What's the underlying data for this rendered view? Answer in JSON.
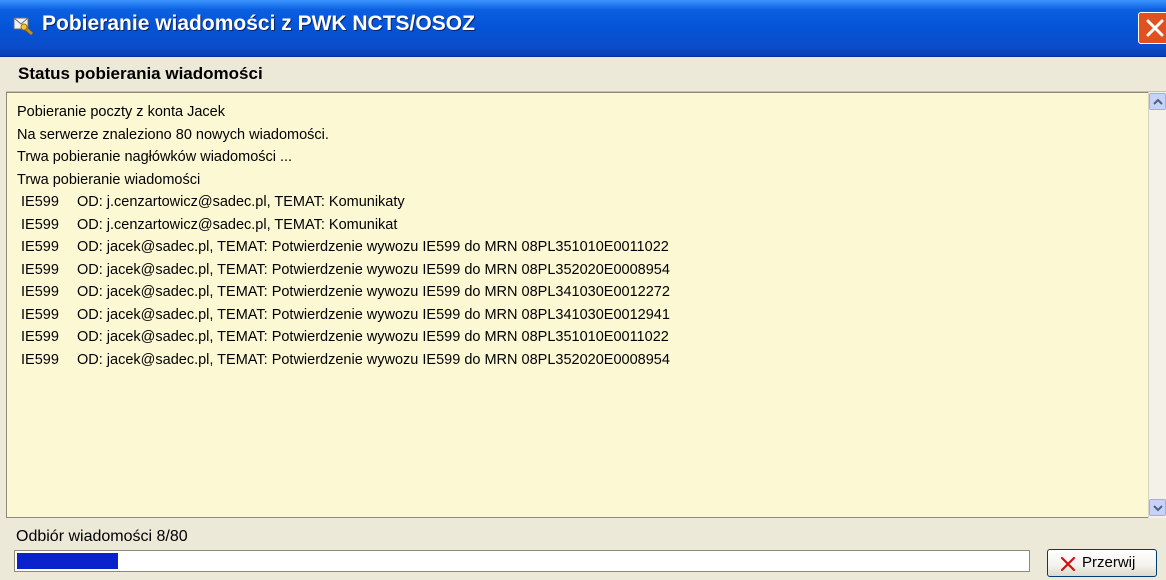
{
  "window": {
    "title": "Pobieranie wiadomości z PWK NCTS/OSOZ",
    "close_label": "×"
  },
  "section": {
    "header": "Status pobierania wiadomości"
  },
  "log": {
    "lines": [
      "Pobieranie poczty z konta Jacek",
      "Na serwerze znaleziono 80 nowych wiadomości.",
      "Trwa pobieranie nagłówków wiadomości ...",
      "Trwa pobieranie wiadomości"
    ],
    "messages": [
      {
        "code": "IE599",
        "text": "OD: j.cenzartowicz@sadec.pl, TEMAT: Komunikaty"
      },
      {
        "code": "IE599",
        "text": "OD: j.cenzartowicz@sadec.pl, TEMAT: Komunikat"
      },
      {
        "code": "IE599",
        "text": "OD: jacek@sadec.pl, TEMAT: Potwierdzenie wywozu IE599 do MRN 08PL351010E0011022"
      },
      {
        "code": "IE599",
        "text": "OD: jacek@sadec.pl, TEMAT: Potwierdzenie wywozu IE599 do MRN 08PL352020E0008954"
      },
      {
        "code": "IE599",
        "text": "OD: jacek@sadec.pl, TEMAT: Potwierdzenie wywozu IE599 do MRN 08PL341030E0012272"
      },
      {
        "code": "IE599",
        "text": "OD: jacek@sadec.pl, TEMAT: Potwierdzenie wywozu IE599 do MRN 08PL341030E0012941"
      },
      {
        "code": "IE599",
        "text": "OD: jacek@sadec.pl, TEMAT: Potwierdzenie wywozu IE599 do MRN 08PL351010E0011022"
      },
      {
        "code": "IE599",
        "text": "OD: jacek@sadec.pl, TEMAT: Potwierdzenie wywozu IE599 do MRN 08PL352020E0008954"
      }
    ]
  },
  "status": {
    "text": "Odbiór wiadomości 8/80",
    "progress_fraction": 0.1
  },
  "buttons": {
    "stop_label": "Przerwij"
  },
  "colors": {
    "titlebar": "#0553d6",
    "log_background": "#fdf8d4",
    "progress_fill": "#0a22cc",
    "close_button": "#e0511f",
    "stop_icon": "#d01010"
  },
  "icons": {
    "title": "window-app-icon",
    "close": "close-icon",
    "scroll_up": "chevron-up-icon",
    "scroll_down": "chevron-down-icon",
    "stop": "x-mark-icon"
  }
}
